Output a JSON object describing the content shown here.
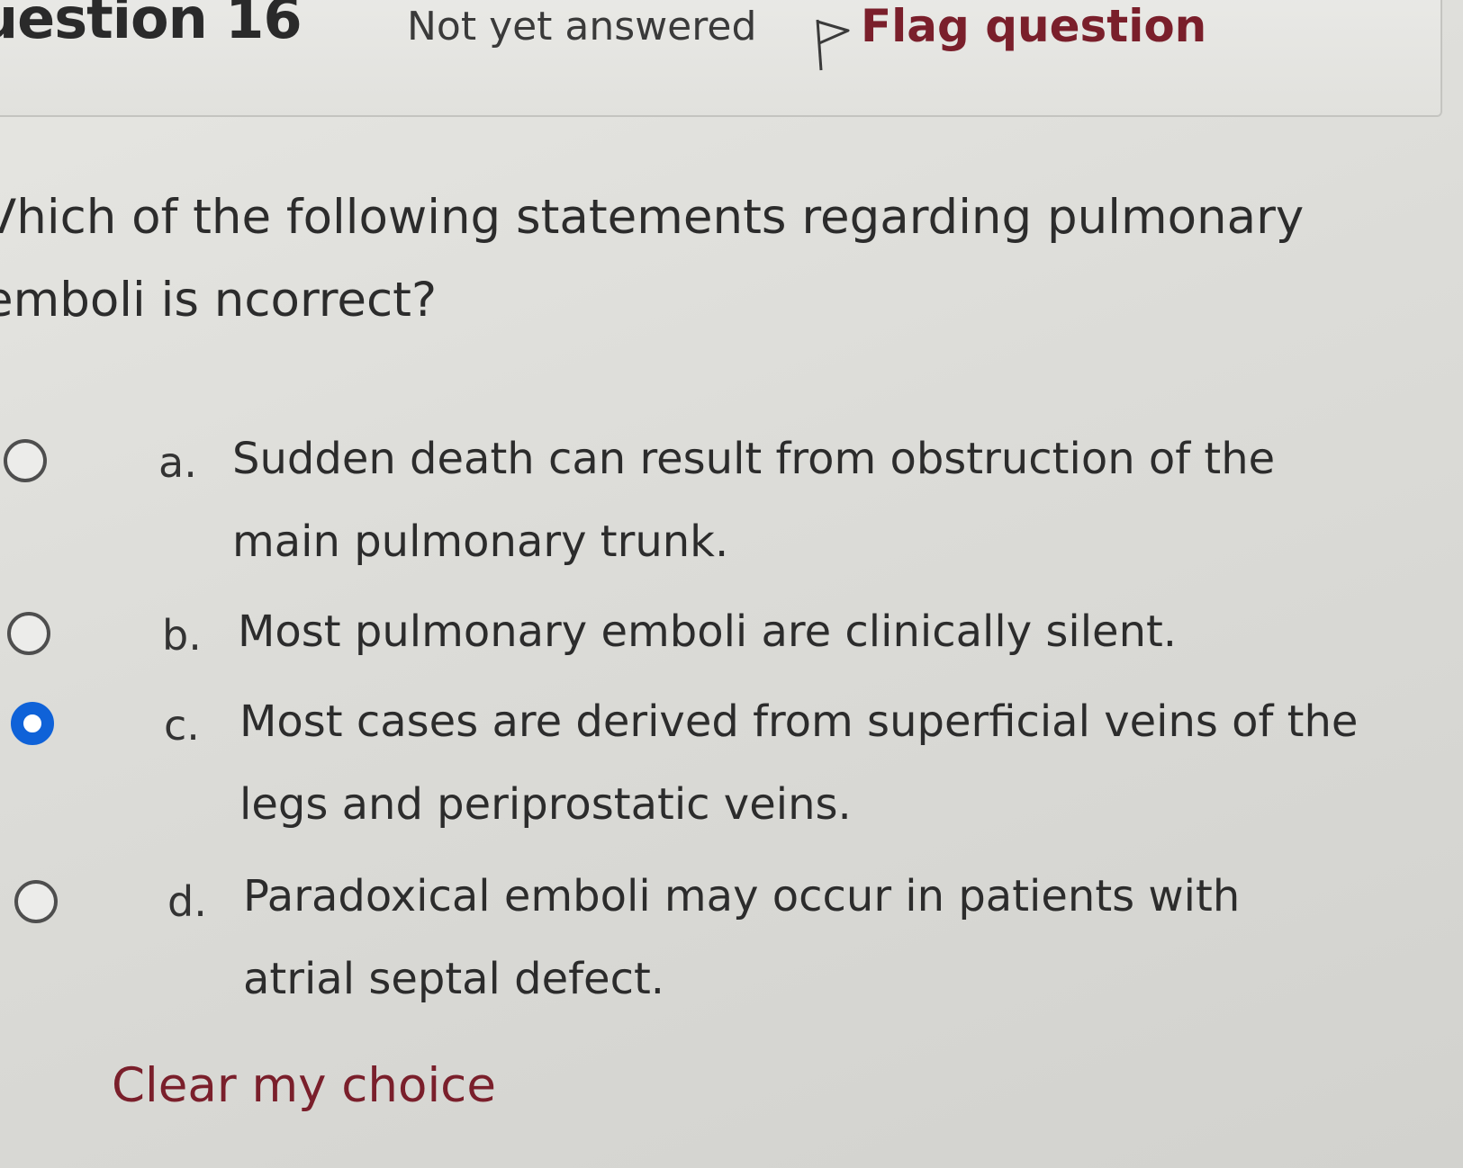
{
  "header": {
    "question_number": "uestion 16",
    "state": "Not yet answered",
    "flag_label": "Flag question"
  },
  "question": {
    "text": "Vhich of the following statements regarding pulmonary emboli is ncorrect?"
  },
  "answers": [
    {
      "letter": "a.",
      "text": "Sudden death can result from obstruction of the main pulmonary trunk.",
      "selected": false
    },
    {
      "letter": "b.",
      "text": "Most pulmonary emboli are clinically silent.",
      "selected": false
    },
    {
      "letter": "c.",
      "text": "Most cases are derived from superficial veins of the legs and periprostatic veins.",
      "selected": true
    },
    {
      "letter": "d.",
      "text": "Paradoxical emboli may occur in patients with atrial septal defect.",
      "selected": false
    }
  ],
  "clear_choice_label": "Clear my choice",
  "colors": {
    "link": "#7a1f2b",
    "radio_selected": "#0f62d8"
  },
  "icons": {
    "flag": "flag-outline-icon"
  }
}
